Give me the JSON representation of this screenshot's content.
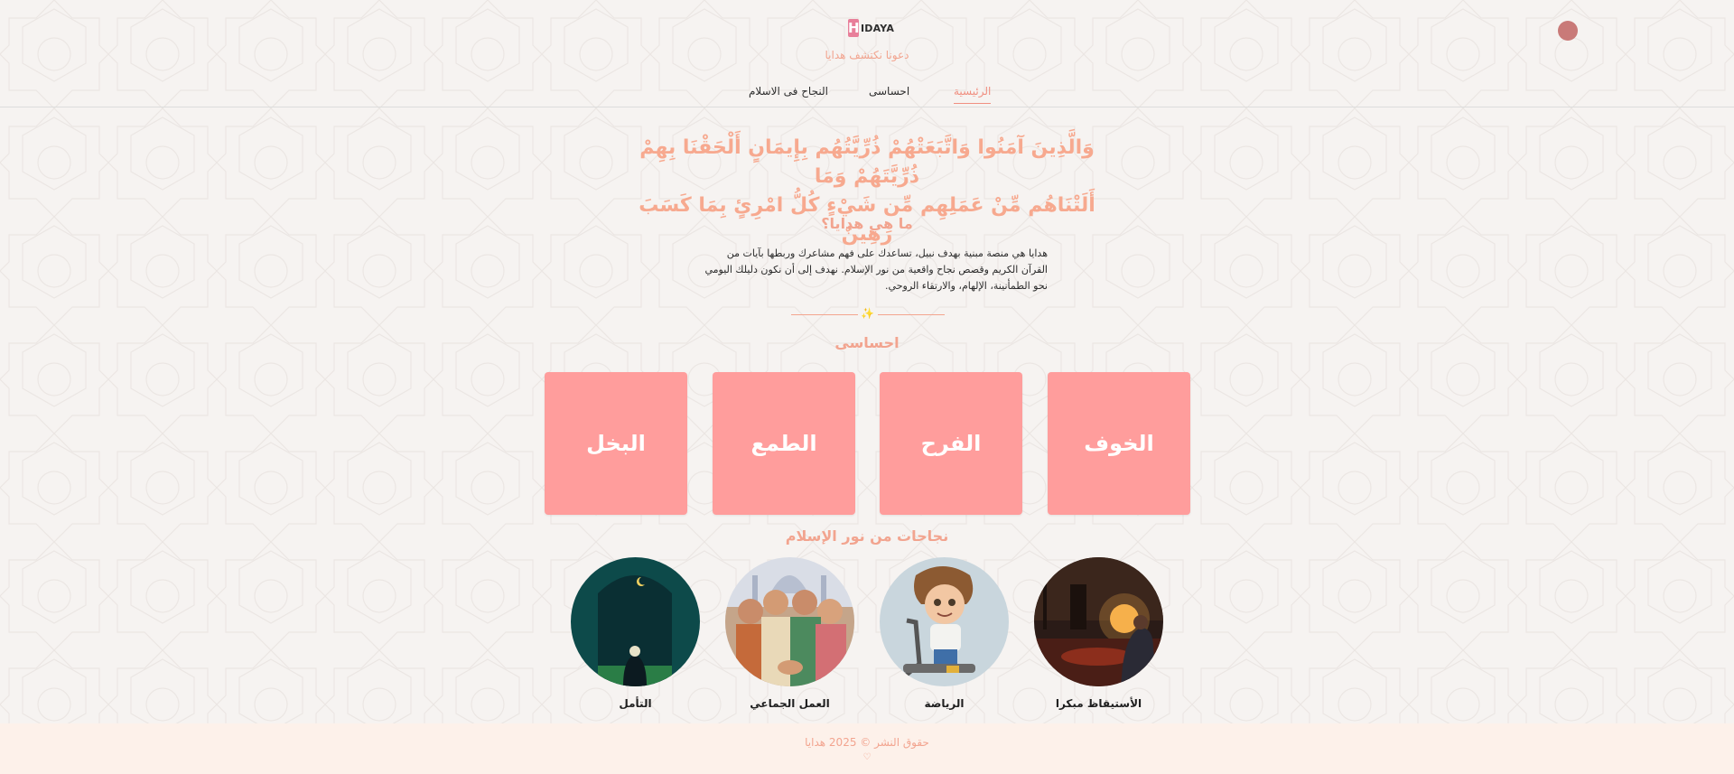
{
  "header": {
    "logo_text": "IDAYA",
    "logo_mark": "H",
    "tagline": "دعونا نكتشف هدايا"
  },
  "nav": {
    "items": [
      {
        "label": "الرئيسية",
        "active": true
      },
      {
        "label": "احساسى",
        "active": false
      },
      {
        "label": "النجاح فى الاسلام",
        "active": false
      }
    ]
  },
  "verse": {
    "line1": "وَالَّذِينَ آمَنُوا وَاتَّبَعَتْهُمْ ذُرِّيَّتُهُم بِإِيمَانٍ أَلْحَقْنَا بِهِمْ ذُرِّيَّتَهُمْ وَمَا",
    "line2": "أَلَتْنَاهُم مِّنْ عَمَلِهِم مِّن شَيْءٍ كُلُّ امْرِئٍ بِمَا كَسَبَ رَهِينٌ"
  },
  "about": {
    "title": "ما هي هدايا؟",
    "text": "هدايا هي منصة مبنية بهدف نبيل، تساعدك على فهم مشاعرك وربطها بآيات من القرآن الكريم وقصص نجاح واقعية من نور الإسلام. نهدف إلى أن نكون دليلك اليومي نحو الطمأنينة، الإلهام، والارتقاء الروحي."
  },
  "divider": {
    "icon": "sparkle-icon",
    "glyph": "✨"
  },
  "feelings": {
    "title": "احساسى",
    "cards": [
      "الخوف",
      "الفرح",
      "الطمع",
      "البخل"
    ]
  },
  "stories": {
    "title": "نجاحات من نور الإسلام",
    "items": [
      "الأستيقاظ مبكرا",
      "الرياضة",
      "العمل الجماعي",
      "التأمل"
    ]
  },
  "footer": {
    "copyright": "حقوق النشر © 2025 هدايا",
    "heart": "♡"
  },
  "colors": {
    "accent": "#f2a48f",
    "card": "#ff9d9c",
    "background": "#f6f3f1",
    "footer_bg": "#fdf1ea"
  }
}
